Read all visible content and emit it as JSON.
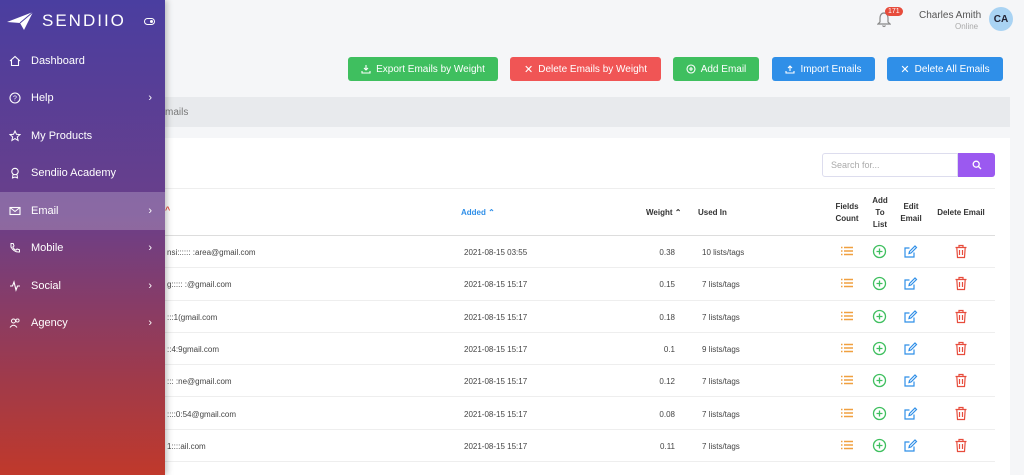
{
  "brand": {
    "name": "SENDIIO"
  },
  "sidebar": {
    "items": [
      {
        "label": "Dashboard",
        "icon": "home-icon",
        "chevron": false,
        "active": false
      },
      {
        "label": "Help",
        "icon": "help-icon",
        "chevron": true,
        "active": false
      },
      {
        "label": "My Products",
        "icon": "star-icon",
        "chevron": false,
        "active": false
      },
      {
        "label": "Sendiio Academy",
        "icon": "award-icon",
        "chevron": false,
        "active": false
      },
      {
        "label": "Email",
        "icon": "mail-icon",
        "chevron": true,
        "active": true
      },
      {
        "label": "Mobile",
        "icon": "phone-icon",
        "chevron": true,
        "active": false
      },
      {
        "label": "Social",
        "icon": "activity-icon",
        "chevron": true,
        "active": false
      },
      {
        "label": "Agency",
        "icon": "users-icon",
        "chevron": true,
        "active": false
      }
    ]
  },
  "header": {
    "notification_count": "171",
    "user_name": "Charles Amith",
    "user_status": "Online",
    "avatar_initials": "CA"
  },
  "actions": {
    "export": "Export Emails by Weight",
    "delete_by_weight": "Delete Emails by Weight",
    "add": "Add Email",
    "import": "Import Emails",
    "delete_all": "Delete All Emails"
  },
  "breadcrumb": {
    "text": "mails"
  },
  "search": {
    "placeholder": "Search for..."
  },
  "table": {
    "headers": {
      "added": "Added",
      "weight": "Weight",
      "used_in": "Used In",
      "fields_count": "Fields Count",
      "add_to_list": "Add To List",
      "edit_email": "Edit Email",
      "delete_email": "Delete Email"
    },
    "rows": [
      {
        "email": "nsi:::::: :area@gmail.com",
        "added": "2021-08-15 03:55",
        "weight": "0.38",
        "used_in": "10 lists/tags"
      },
      {
        "email": "g::::: :@gmail.com",
        "added": "2021-08-15 15:17",
        "weight": "0.15",
        "used_in": "7 lists/tags"
      },
      {
        "email": ":::1(gmail.com",
        "added": "2021-08-15 15:17",
        "weight": "0.18",
        "used_in": "7 lists/tags"
      },
      {
        "email": "::4:9gmail.com",
        "added": "2021-08-15 15:17",
        "weight": "0.1",
        "used_in": "9 lists/tags"
      },
      {
        "email": "::: :ne@gmail.com",
        "added": "2021-08-15 15:17",
        "weight": "0.12",
        "used_in": "7 lists/tags"
      },
      {
        "email": "::::0:54@gmail.com",
        "added": "2021-08-15 15:17",
        "weight": "0.08",
        "used_in": "7 lists/tags"
      },
      {
        "email": "1::::ail.com",
        "added": "2021-08-15 15:17",
        "weight": "0.11",
        "used_in": "7 lists/tags"
      }
    ]
  },
  "colors": {
    "accent_purple": "#9b59f0",
    "green": "#3fbf5f",
    "red": "#f05555",
    "blue": "#2f8fe8",
    "orange_icon": "#f0a040"
  }
}
